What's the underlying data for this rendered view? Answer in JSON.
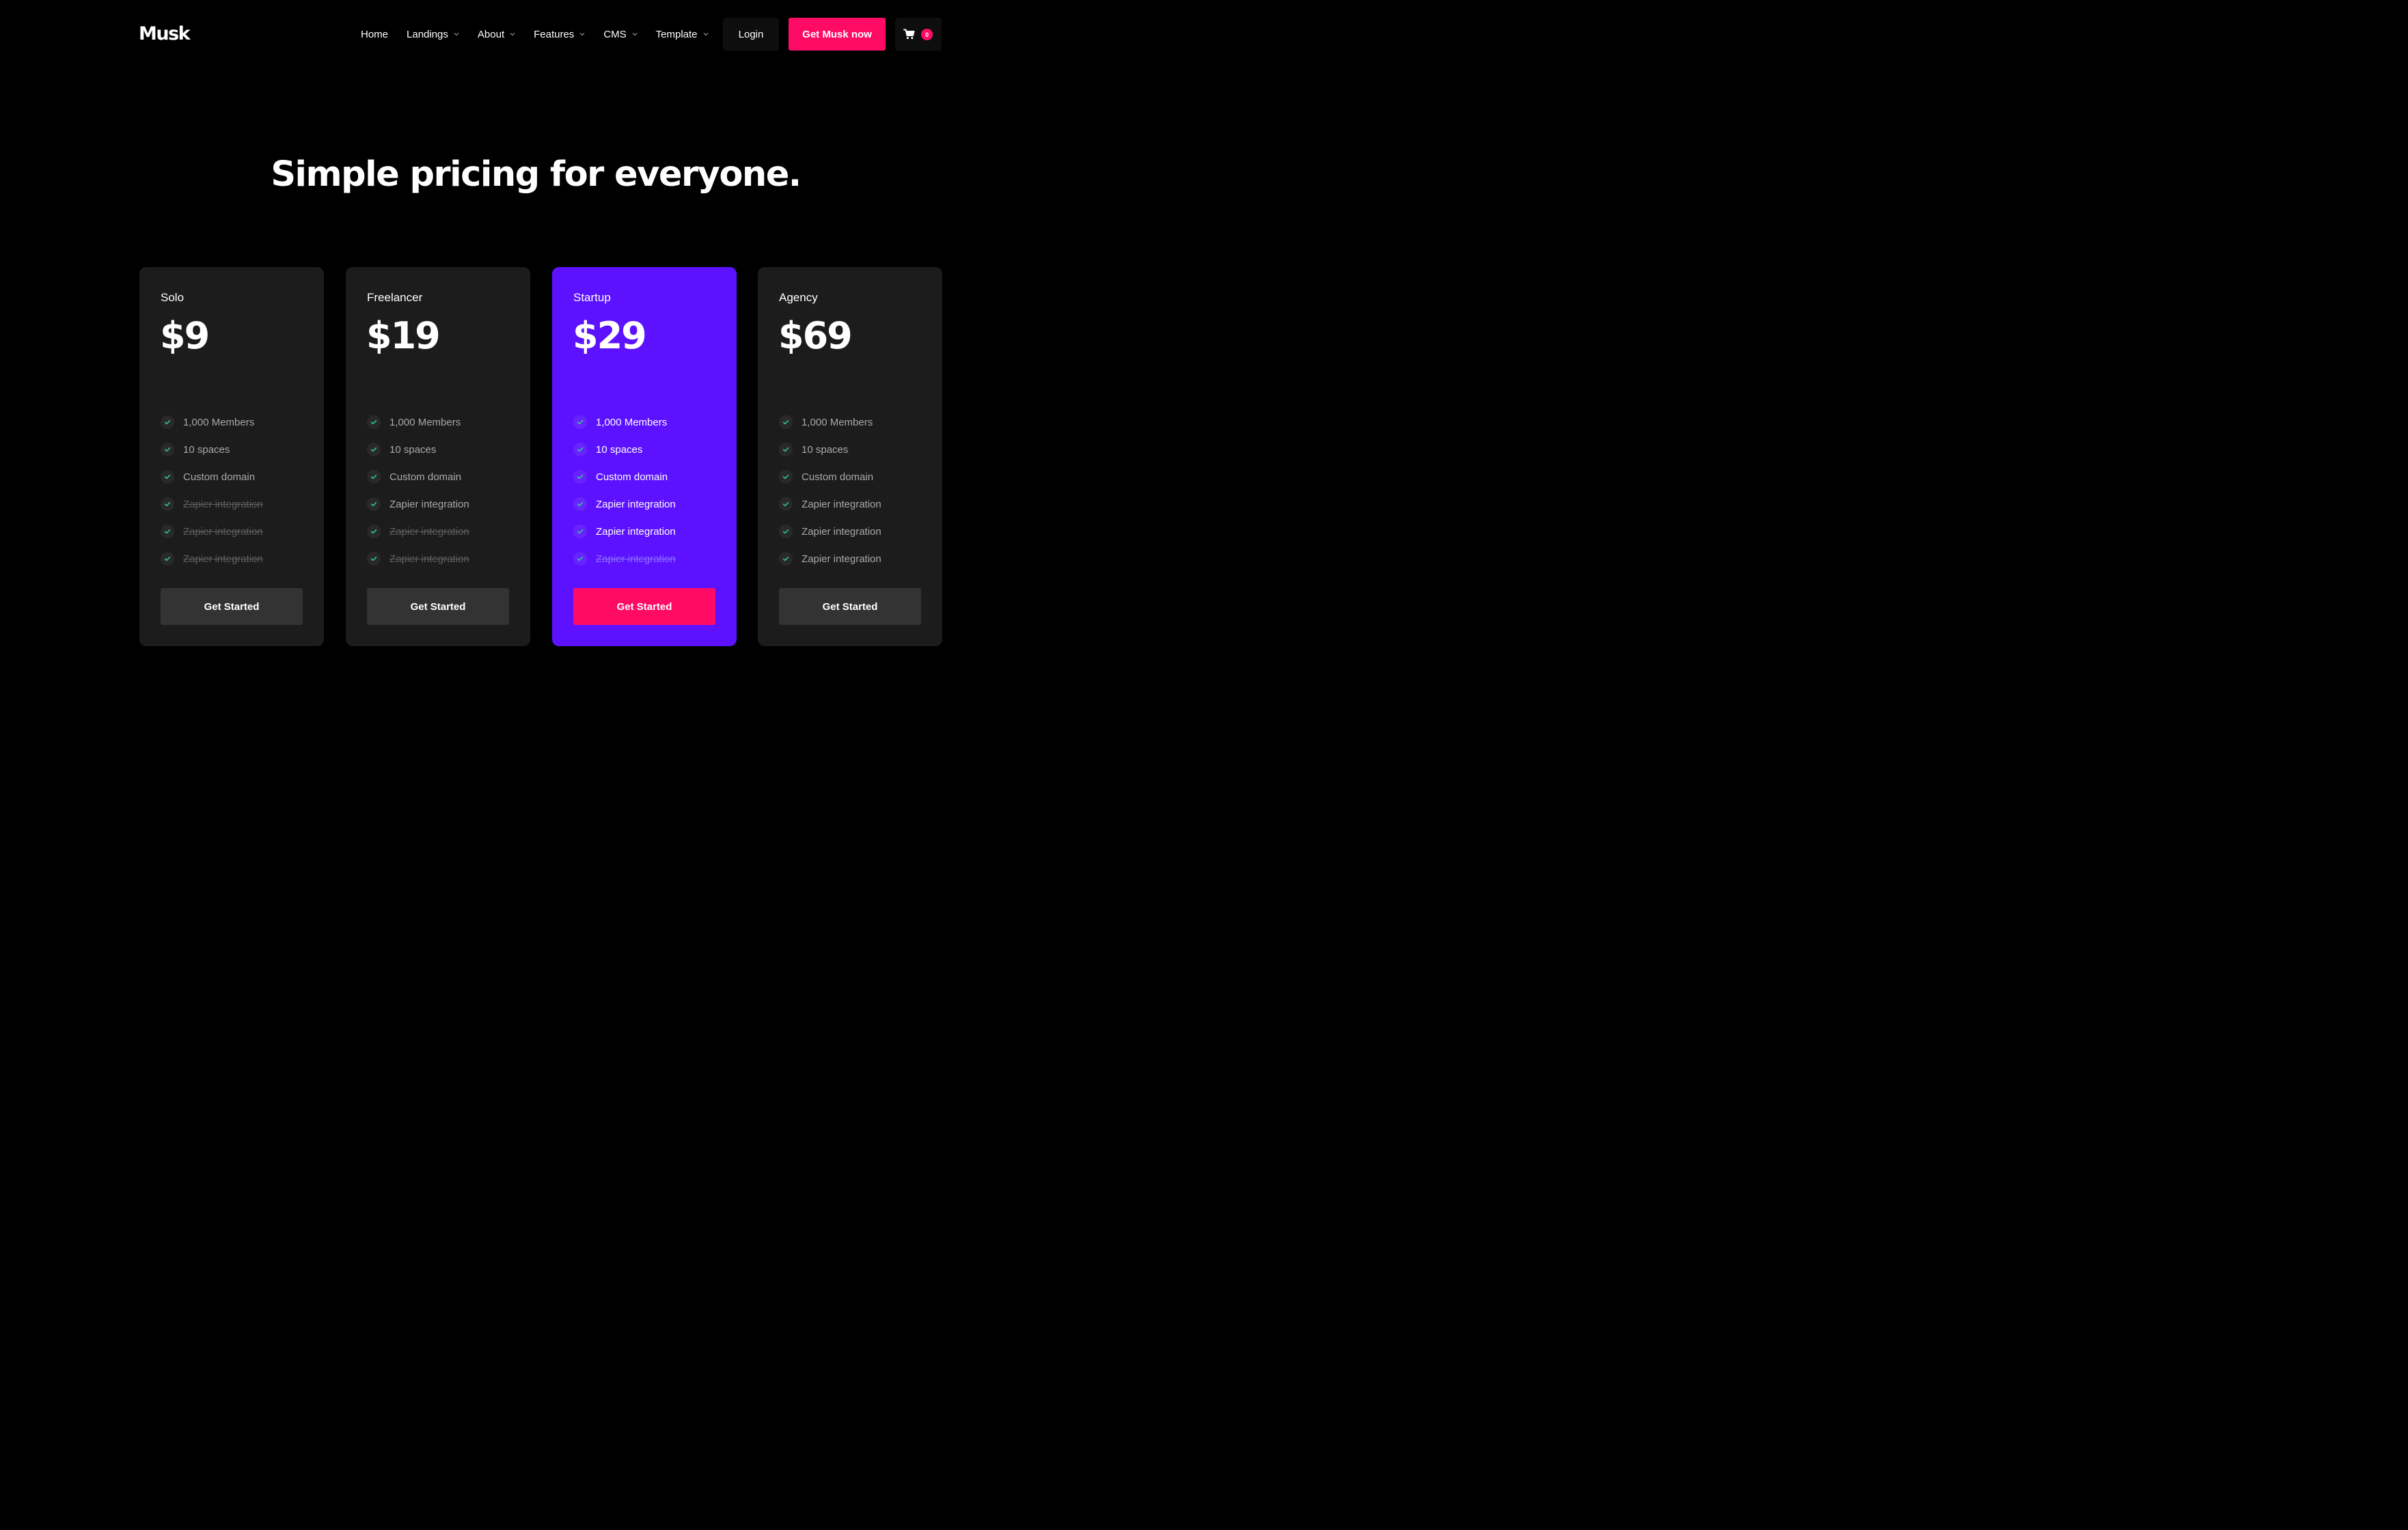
{
  "brand": {
    "logo": "Musk"
  },
  "nav": {
    "items": [
      {
        "label": "Home",
        "has_dropdown": false
      },
      {
        "label": "Landings",
        "has_dropdown": true
      },
      {
        "label": "About",
        "has_dropdown": true
      },
      {
        "label": "Features",
        "has_dropdown": true
      },
      {
        "label": "CMS",
        "has_dropdown": true
      },
      {
        "label": "Template",
        "has_dropdown": true
      }
    ],
    "login_label": "Login",
    "cta_label": "Get Musk now",
    "cart_count": "0",
    "cart_icon": "shopping-cart-icon",
    "dropdown_icon": "chevron-down-icon"
  },
  "hero": {
    "title": "Simple pricing for everyone."
  },
  "colors": {
    "background": "#000000",
    "card": "#1c1c1c",
    "featured_card": "#5c12ff",
    "accent": "#ff0b66",
    "check": "#2fd08b"
  },
  "plans": [
    {
      "name": "Solo",
      "price": "$9",
      "featured": false,
      "features": [
        {
          "label": "1,000 Members",
          "included": true
        },
        {
          "label": "10 spaces",
          "included": true
        },
        {
          "label": "Custom domain",
          "included": true
        },
        {
          "label": "Zapier integration",
          "included": false
        },
        {
          "label": "Zapier integration",
          "included": false
        },
        {
          "label": "Zapier integration",
          "included": false
        }
      ],
      "button_label": "Get Started"
    },
    {
      "name": "Freelancer",
      "price": "$19",
      "featured": false,
      "features": [
        {
          "label": "1,000 Members",
          "included": true
        },
        {
          "label": "10 spaces",
          "included": true
        },
        {
          "label": "Custom domain",
          "included": true
        },
        {
          "label": "Zapier integration",
          "included": true
        },
        {
          "label": "Zapier integration",
          "included": false
        },
        {
          "label": "Zapier integration",
          "included": false
        }
      ],
      "button_label": "Get Started"
    },
    {
      "name": "Startup",
      "price": "$29",
      "featured": true,
      "features": [
        {
          "label": "1,000 Members",
          "included": true
        },
        {
          "label": "10 spaces",
          "included": true
        },
        {
          "label": "Custom domain",
          "included": true
        },
        {
          "label": "Zapier integration",
          "included": true
        },
        {
          "label": "Zapier integration",
          "included": true
        },
        {
          "label": "Zapier integration",
          "included": false
        }
      ],
      "button_label": "Get Started"
    },
    {
      "name": "Agency",
      "price": "$69",
      "featured": false,
      "features": [
        {
          "label": "1,000 Members",
          "included": true
        },
        {
          "label": "10 spaces",
          "included": true
        },
        {
          "label": "Custom domain",
          "included": true
        },
        {
          "label": "Zapier integration",
          "included": true
        },
        {
          "label": "Zapier integration",
          "included": true
        },
        {
          "label": "Zapier integration",
          "included": true
        }
      ],
      "button_label": "Get Started"
    }
  ]
}
